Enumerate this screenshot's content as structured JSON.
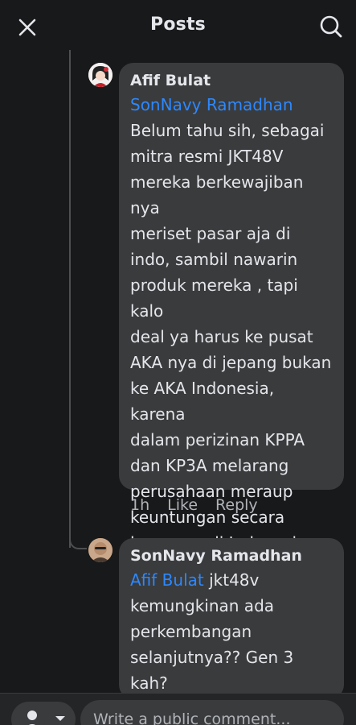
{
  "header": {
    "title": "Posts"
  },
  "comments": [
    {
      "author": "Afif Bulat",
      "mention": "SonNavy Ramadhan",
      "text": "Belum tahu sih, sebagai\nmitra resmi JKT48V\nmereka berkewajiban nya\nmeriset pasar aja di\nindo, sambil nawarin\nproduk mereka , tapi kalo\ndeal ya harus ke pusat\nAKA nya di jepang bukan\nke AKA Indonesia, karena\ndalam perizinan KPPA\ndan KP3A melarang\nperusahaan meraup\nkeuntungan secara\nlangsung di Indonesia",
      "meta": {
        "time": "1h",
        "like": "Like",
        "reply": "Reply"
      }
    },
    {
      "author": "SonNavy Ramadhan",
      "mention": "Afif Bulat",
      "text_inline": " jkt48v",
      "text": "kemungkinan ada\nperkembangan\nselanjutnya?? Gen 3\nkah?"
    }
  ],
  "composer": {
    "placeholder": "Write a public comment..."
  },
  "colors": {
    "background": "#18191a",
    "bubble": "#3a3b3c",
    "mention": "#2d88ff"
  }
}
